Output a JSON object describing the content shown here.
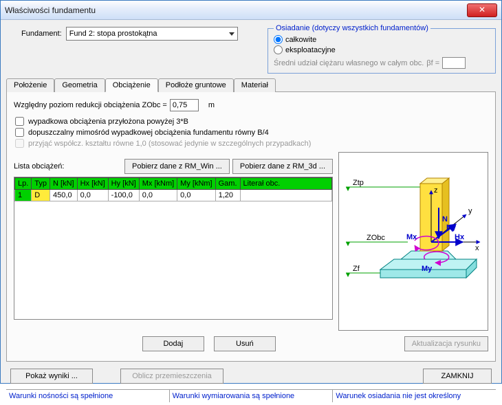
{
  "window_title": "Właściwości fundamentu",
  "fundament_label": "Fundament:",
  "fundament_value": "Fund 2: stopa prostokątna",
  "osiadanie": {
    "legend": "Osiadanie  (dotyczy wszystkich fundamentów)",
    "r1": "całkowite",
    "r2": "eksploatacyjne",
    "grayline": "Średni udział ciężaru własnego w całym obc.",
    "beta": "βf ="
  },
  "tabs": {
    "t1": "Położenie",
    "t2": "Geometria",
    "t3": "Obciążenie",
    "t4": "Podłoże gruntowe",
    "t5": "Materiał"
  },
  "panel": {
    "wz_label": "Względny poziom redukcji obciążenia  ZObc =",
    "wz_val": "0,75",
    "wz_unit": "m",
    "chk1": "wypadkowa obciążenia przyłożona powyżej 3*B",
    "chk2": "dopuszczalny mimośród wypadkowej obciążenia fundamentu równy  B/4",
    "chk3": "przyjąć współcz. kształtu równe  1,0  (stosować jedynie w szczególnych przypadkach)",
    "lista_label": "Lista obciążeń:",
    "btn_rmwin": "Pobierz dane z RM_Win ...",
    "btn_rm3d": "Pobierz dane z RM_3d ...",
    "btn_dodaj": "Dodaj",
    "btn_usun": "Usuń",
    "btn_rys": "Aktualizacja rysunku"
  },
  "table": {
    "headers": [
      "Lp.",
      "Typ",
      "N [kN]",
      "Hx [kN]",
      "Hy [kN]",
      "Mx [kNm]",
      "My [kNm]",
      "Gam.",
      "Literał obc."
    ],
    "rows": [
      {
        "lp": "1",
        "typ": "D",
        "n": "450,0",
        "hx": "0,0",
        "hy": "-100,0",
        "mx": "0,0",
        "my": "0,0",
        "gam": "1,20",
        "lit": ""
      }
    ]
  },
  "diagram": {
    "ztp": "Ztp",
    "zobc": "ZObc",
    "zf": "Zf",
    "N": "N",
    "Hy": "Hy",
    "Hx": "Hx",
    "Mx": "Mx",
    "My": "My",
    "x": "x",
    "y": "y",
    "z": "z"
  },
  "footer": {
    "pokaz": "Pokaż wyniki ...",
    "oblicz": "Oblicz przemieszczenia",
    "zamknij": "ZAMKNIJ"
  },
  "status": {
    "s1": "Warunki nośności są spełnione",
    "s2": "Warunki wymiarowania są spełnione",
    "s3": "Warunek osiadania nie jest określony"
  }
}
